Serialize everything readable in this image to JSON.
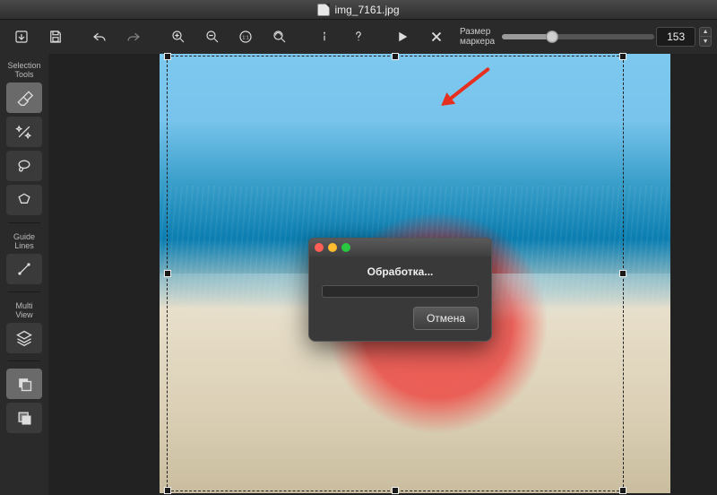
{
  "window": {
    "filename": "img_7161.jpg"
  },
  "toolbar": {
    "marker_label_line1": "Размер",
    "marker_label_line2": "маркера",
    "marker_value": "153"
  },
  "sidebar": {
    "sections": {
      "selection": {
        "line1": "Selection",
        "line2": "Tools"
      },
      "guide": {
        "line1": "Guide",
        "line2": "Lines"
      },
      "multi": {
        "line1": "Multi",
        "line2": "View"
      }
    }
  },
  "dialog": {
    "title": "Обработка...",
    "cancel": "Отмена"
  },
  "annotation": {
    "arrow_color": "#e6301f"
  }
}
